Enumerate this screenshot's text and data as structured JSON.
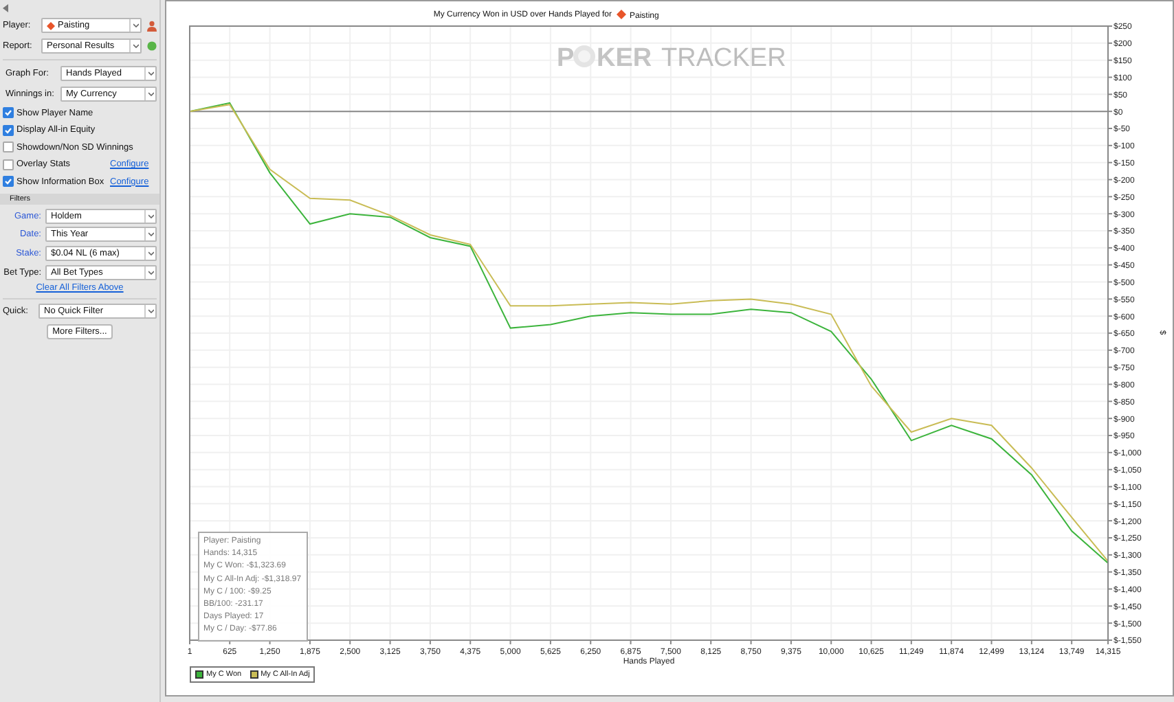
{
  "sidebar": {
    "selects": [
      {
        "kind": "player",
        "label": "Player:",
        "value": "Paisting"
      },
      {
        "kind": "report",
        "label": "Report:",
        "value": "Personal Results"
      }
    ],
    "graph_selects": [
      {
        "label": "Graph For:",
        "value": "Hands Played"
      },
      {
        "label": "Winnings in:",
        "value": "My Currency"
      }
    ],
    "options": [
      {
        "label": "Show Player Name",
        "checked": true
      },
      {
        "label": "Display All-in Equity",
        "checked": true
      },
      {
        "label": "Showdown/Non SD Winnings",
        "checked": false
      },
      {
        "label": "Overlay Stats",
        "checked": false,
        "link": "Configure"
      },
      {
        "label": "Show Information Box",
        "checked": true,
        "link": "Configure"
      }
    ],
    "filters": {
      "title": "Filters",
      "items": [
        {
          "label": "Game:",
          "value": "Holdem",
          "active": true
        },
        {
          "label": "Date:",
          "value": "This Year",
          "active": true
        },
        {
          "label": "Stake:",
          "value": "$0.04 NL (6 max)",
          "active": true
        },
        {
          "label": "Bet Type:",
          "value": "All Bet Types",
          "active": false
        }
      ],
      "clear_link": "Clear All Filters Above",
      "quick": {
        "label": "Quick:",
        "value": "No Quick Filter"
      },
      "more_button": "More Filters..."
    }
  },
  "chart": {
    "title": "My Currency Won in USD over Hands Played for",
    "player": "Paisting",
    "watermark": {
      "lead": "P",
      "bold": "KER",
      "light": "TRACKER"
    },
    "info_box": [
      "Player: Paisting",
      "Hands: 14,315",
      "My C Won: -$1,323.69",
      "My C All-In Adj: -$1,318.97",
      "My C / 100: -$9.25",
      "BB/100: -231.17",
      "Days Played: 17",
      "My C / Day: -$77.86"
    ],
    "chart_data": {
      "type": "line",
      "grid": true,
      "xlabel": "Hands Played",
      "ylabel": "$",
      "x": [
        1,
        625,
        1250,
        1875,
        2500,
        3125,
        3750,
        4375,
        5000,
        5625,
        6250,
        6875,
        7500,
        8125,
        8750,
        9375,
        10000,
        10625,
        11249,
        11874,
        12499,
        13124,
        13749,
        14315
      ],
      "series": [
        {
          "name": "My C Won",
          "color": "#3cb43c",
          "values": [
            0,
            25,
            -180,
            -330,
            -300,
            -310,
            -370,
            -395,
            -635,
            -625,
            -600,
            -590,
            -595,
            -595,
            -580,
            -590,
            -645,
            -785,
            -965,
            -920,
            -960,
            -1065,
            -1230,
            -1324
          ]
        },
        {
          "name": "My C All-In Adj",
          "color": "#c9bc55",
          "values": [
            0,
            20,
            -170,
            -255,
            -260,
            -305,
            -362,
            -390,
            -570,
            -570,
            -565,
            -560,
            -565,
            -555,
            -550,
            -565,
            -595,
            -805,
            -940,
            -900,
            -920,
            -1045,
            -1190,
            -1319
          ]
        }
      ],
      "xlim": [
        1,
        14315
      ],
      "ylim": [
        -1550,
        250
      ],
      "xticks": [
        {
          "value": 1,
          "label": "1"
        },
        {
          "value": 625,
          "label": "625"
        },
        {
          "value": 1250,
          "label": "1,250"
        },
        {
          "value": 1875,
          "label": "1,875"
        },
        {
          "value": 2500,
          "label": "2,500"
        },
        {
          "value": 3125,
          "label": "3,125"
        },
        {
          "value": 3750,
          "label": "3,750"
        },
        {
          "value": 4375,
          "label": "4,375"
        },
        {
          "value": 5000,
          "label": "5,000"
        },
        {
          "value": 5625,
          "label": "5,625"
        },
        {
          "value": 6250,
          "label": "6,250"
        },
        {
          "value": 6875,
          "label": "6,875"
        },
        {
          "value": 7500,
          "label": "7,500"
        },
        {
          "value": 8125,
          "label": "8,125"
        },
        {
          "value": 8750,
          "label": "8,750"
        },
        {
          "value": 9375,
          "label": "9,375"
        },
        {
          "value": 10000,
          "label": "10,000"
        },
        {
          "value": 10625,
          "label": "10,625"
        },
        {
          "value": 11249,
          "label": "11,249"
        },
        {
          "value": 11874,
          "label": "11,874"
        },
        {
          "value": 12499,
          "label": "12,499"
        },
        {
          "value": 13124,
          "label": "13,124"
        },
        {
          "value": 13749,
          "label": "13,749"
        },
        {
          "value": 14315,
          "label": "14,315"
        }
      ],
      "yticks": [
        {
          "value": 250,
          "label": "$250"
        },
        {
          "value": 200,
          "label": "$200"
        },
        {
          "value": 150,
          "label": "$150"
        },
        {
          "value": 100,
          "label": "$100"
        },
        {
          "value": 50,
          "label": "$50"
        },
        {
          "value": 0,
          "label": "$0"
        },
        {
          "value": -50,
          "label": "$-50"
        },
        {
          "value": -100,
          "label": "$-100"
        },
        {
          "value": -150,
          "label": "$-150"
        },
        {
          "value": -200,
          "label": "$-200"
        },
        {
          "value": -250,
          "label": "$-250"
        },
        {
          "value": -300,
          "label": "$-300"
        },
        {
          "value": -350,
          "label": "$-350"
        },
        {
          "value": -400,
          "label": "$-400"
        },
        {
          "value": -450,
          "label": "$-450"
        },
        {
          "value": -500,
          "label": "$-500"
        },
        {
          "value": -550,
          "label": "$-550"
        },
        {
          "value": -600,
          "label": "$-600"
        },
        {
          "value": -650,
          "label": "$-650"
        },
        {
          "value": -700,
          "label": "$-700"
        },
        {
          "value": -750,
          "label": "$-750"
        },
        {
          "value": -800,
          "label": "$-800"
        },
        {
          "value": -850,
          "label": "$-850"
        },
        {
          "value": -900,
          "label": "$-900"
        },
        {
          "value": -950,
          "label": "$-950"
        },
        {
          "value": -1000,
          "label": "$-1,000"
        },
        {
          "value": -1050,
          "label": "$-1,050"
        },
        {
          "value": -1100,
          "label": "$-1,100"
        },
        {
          "value": -1150,
          "label": "$-1,150"
        },
        {
          "value": -1200,
          "label": "$-1,200"
        },
        {
          "value": -1250,
          "label": "$-1,250"
        },
        {
          "value": -1300,
          "label": "$-1,300"
        },
        {
          "value": -1350,
          "label": "$-1,350"
        },
        {
          "value": -1400,
          "label": "$-1,400"
        },
        {
          "value": -1450,
          "label": "$-1,450"
        },
        {
          "value": -1500,
          "label": "$-1,500"
        },
        {
          "value": -1550,
          "label": "$-1,550"
        }
      ]
    }
  }
}
